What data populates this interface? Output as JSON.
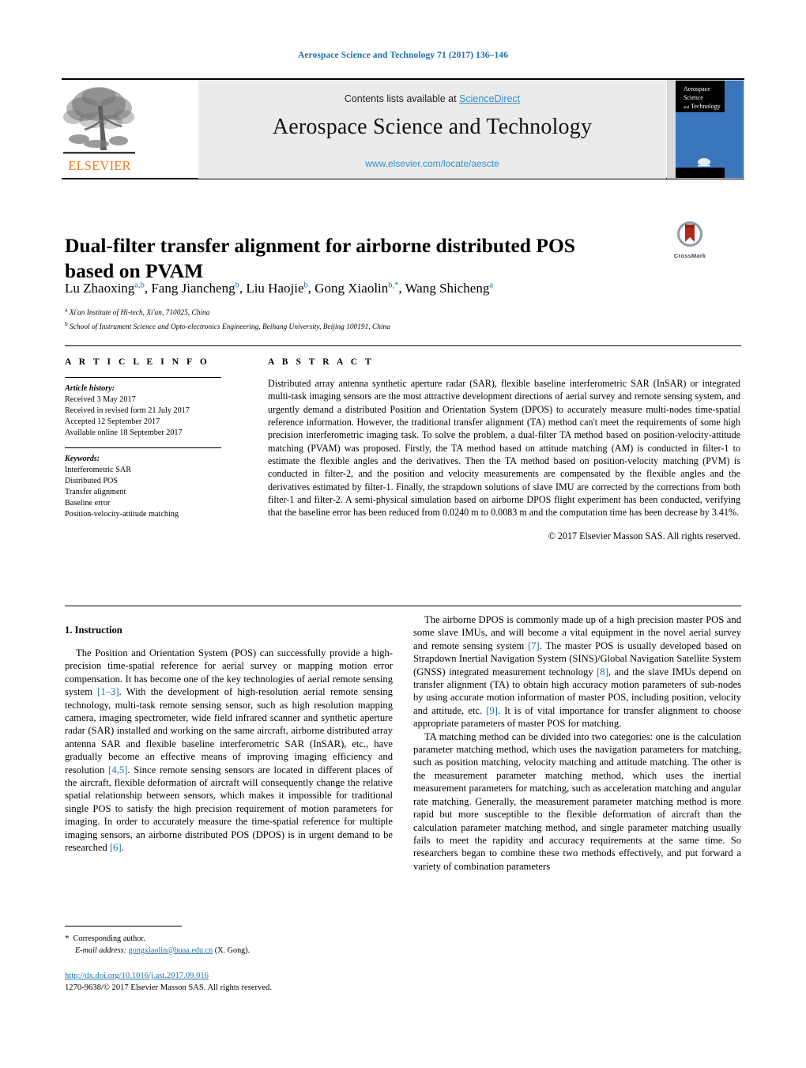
{
  "running_head": "Aerospace Science and Technology 71 (2017) 136–146",
  "masthead": {
    "contents_prefix": "Contents lists available at ",
    "sciencedirect": "ScienceDirect",
    "journal_title": "Aerospace Science and Technology",
    "journal_url": "www.elsevier.com/locate/aescte",
    "publisher": "ELSEVIER",
    "cover_title_line1": "Aerospace",
    "cover_title_line2": "Science",
    "cover_title_line3": "and",
    "cover_title_line4": "Technology",
    "accent_orange": "#F47A20",
    "link_blue": "#2f8fc6",
    "cover_blue": "#3b76bd"
  },
  "article": {
    "title": "Dual-filter transfer alignment for airborne distributed POS based on PVAM",
    "crossmark_label": "CrossMark",
    "authors": [
      {
        "name": "Lu Zhaoxing",
        "sup": "a,b",
        "sep": ", "
      },
      {
        "name": "Fang Jiancheng",
        "sup": "b",
        "sep": ", "
      },
      {
        "name": "Liu Haojie",
        "sup": "b",
        "sep": ", "
      },
      {
        "name": "Gong Xiaolin",
        "sup": "b,*",
        "sep": ", "
      },
      {
        "name": "Wang Shicheng",
        "sup": "a",
        "sep": ""
      }
    ],
    "affiliations": [
      {
        "marker": "a",
        "text": "Xi'an Institute of Hi-tech, Xi'an, 710025, China"
      },
      {
        "marker": "b",
        "text": "School of Instrument Science and Opto-electronics Engineering, Beihang University, Beijing 100191, China"
      }
    ]
  },
  "article_info": {
    "heading": "A R T I C L E  I N F O",
    "history_label": "Article history:",
    "history": [
      "Received 3 May 2017",
      "Received in revised form 21 July 2017",
      "Accepted 12 September 2017",
      "Available online 18 September 2017"
    ],
    "keywords_label": "Keywords:",
    "keywords": [
      "Interferometric SAR",
      "Distributed POS",
      "Transfer alignment",
      "Baseline error",
      "Position-velocity-attitude matching"
    ]
  },
  "abstract": {
    "heading": "A B S T R A C T",
    "text": "Distributed array antenna synthetic aperture radar (SAR), flexible baseline interferometric SAR (InSAR) or integrated multi-task imaging sensors are the most attractive development directions of aerial survey and remote sensing system, and urgently demand a distributed Position and Orientation System (DPOS) to accurately measure multi-nodes time-spatial reference information. However, the traditional transfer alignment (TA) method can't meet the requirements of some high precision interferometric imaging task. To solve the problem, a dual-filter TA method based on position-velocity-attitude matching (PVAM) was proposed. Firstly, the TA method based on attitude matching (AM) is conducted in filter-1 to estimate the flexible angles and the derivatives. Then the TA method based on position-velocity matching (PVM) is conducted in filter-2, and the position and velocity measurements are compensated by the flexible angles and the derivatives estimated by filter-1. Finally, the strapdown solutions of slave IMU are corrected by the corrections from both filter-1 and filter-2. A semi-physical simulation based on airborne DPOS flight experiment has been conducted, verifying that the baseline error has been reduced from 0.0240 m to 0.0083 m and the computation time has been decrease by 3.41%.",
    "copyright": "© 2017 Elsevier Masson SAS. All rights reserved."
  },
  "body": {
    "section_heading": "1. Instruction",
    "left_paragraphs": [
      {
        "parts": [
          {
            "t": "The Position and Orientation System (POS) can successfully provide a high-precision time-spatial reference for aerial survey or mapping motion error compensation. It has become one of the key technologies of aerial remote sensing system "
          },
          {
            "t": "[1–3]",
            "ref": true
          },
          {
            "t": ". With the development of high-resolution aerial remote sensing technology, multi-task remote sensing sensor, such as high resolution mapping camera, imaging spectrometer, wide field infrared scanner and synthetic aperture radar (SAR) installed and working on the same aircraft, airborne distributed array antenna SAR and flexible baseline interferometric SAR (InSAR), etc., have gradually become an effective means of improving imaging efficiency and resolution "
          },
          {
            "t": "[4,5]",
            "ref": true
          },
          {
            "t": ". Since remote sensing sensors are located in different places of the aircraft, flexible deformation of aircraft will consequently change the relative spatial relationship between sensors, which makes it impossible for traditional single POS to satisfy the high precision requirement of motion parameters for imaging. In order to accurately measure the time-spatial reference for multiple imaging sensors, an airborne distributed POS (DPOS) is in urgent demand to be researched "
          },
          {
            "t": "[6]",
            "ref": true
          },
          {
            "t": "."
          }
        ]
      }
    ],
    "right_paragraphs": [
      {
        "parts": [
          {
            "t": "The airborne DPOS is commonly made up of a high precision master POS and some slave IMUs, and will become a vital equipment in the novel aerial survey and remote sensing system "
          },
          {
            "t": "[7]",
            "ref": true
          },
          {
            "t": ". The master POS is usually developed based on Strapdown Inertial Navigation System (SINS)/Global Navigation Satellite System (GNSS) integrated measurement technology "
          },
          {
            "t": "[8]",
            "ref": true
          },
          {
            "t": ", and the slave IMUs depend on transfer alignment (TA) to obtain high accuracy motion parameters of sub-nodes by using accurate motion information of master POS, including position, velocity and attitude, etc. "
          },
          {
            "t": "[9]",
            "ref": true
          },
          {
            "t": ". It is of vital importance for transfer alignment to choose appropriate parameters of master POS for matching."
          }
        ]
      },
      {
        "parts": [
          {
            "t": "TA matching method can be divided into two categories: one is the calculation parameter matching method, which uses the navigation parameters for matching, such as position matching, velocity matching and attitude matching. The other is the measurement parameter matching method, which uses the inertial measurement parameters for matching, such as acceleration matching and angular rate matching. Generally, the measurement parameter matching method is more rapid but more susceptible to the flexible deformation of aircraft than the calculation parameter matching method, and single parameter matching usually fails to meet the rapidity and accuracy requirements at the same time. So researchers began to combine these two methods effectively, and put forward a variety of combination parameters"
          }
        ]
      }
    ]
  },
  "footer": {
    "corresponding_marker": "*",
    "corresponding_text": "Corresponding author.",
    "email_label": "E-mail address:",
    "email": "gongxiaolin@buaa.edu.cn",
    "email_suffix": "(X. Gong).",
    "doi": "http://dx.doi.org/10.1016/j.ast.2017.09.016",
    "issn_line": "1270-9638/© 2017 Elsevier Masson SAS. All rights reserved."
  }
}
